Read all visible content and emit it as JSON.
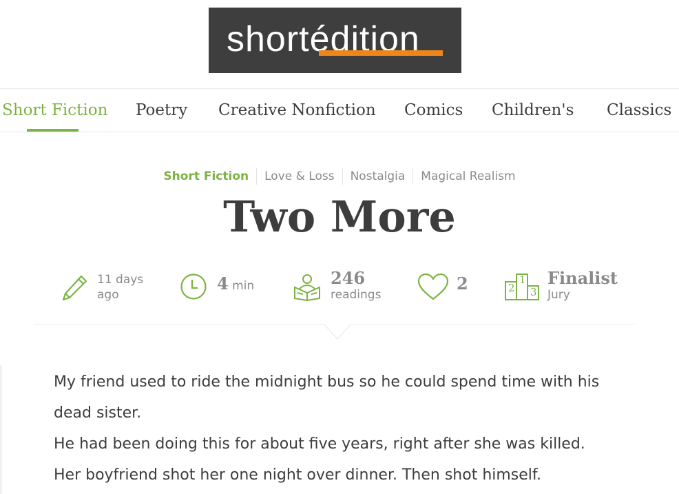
{
  "logo": {
    "text": "shortédition"
  },
  "nav": {
    "items": [
      "Short Fiction",
      "Poetry",
      "Creative Nonfiction",
      "Comics",
      "Children's",
      "Classics"
    ],
    "active": "Short Fiction"
  },
  "tags": [
    "Short Fiction",
    "Love & Loss",
    "Nostalgia",
    "Magical Realism"
  ],
  "title": "Two More",
  "stats": {
    "date_line1": "11 days",
    "date_line2": "ago",
    "read_time_value": "4",
    "read_time_unit": "min",
    "readings_value": "246",
    "readings_label": "readings",
    "likes": "2",
    "award": "Finalist",
    "award_sub": "Jury",
    "podium_digits": [
      "2",
      "1",
      "3"
    ]
  },
  "story": {
    "lines": [
      "My friend used to ride the midnight bus so he could spend time with his",
      "dead sister.",
      "He had been doing this for about five years, right after she was killed.",
      "Her boyfriend shot her one night over dinner. Then shot himself."
    ]
  },
  "colors": {
    "accent": "#7cb342",
    "logo_bg": "#3e3e3e",
    "logo_orange": "#f08519",
    "text": "#3d3d3d",
    "muted": "#8a8a8a"
  }
}
